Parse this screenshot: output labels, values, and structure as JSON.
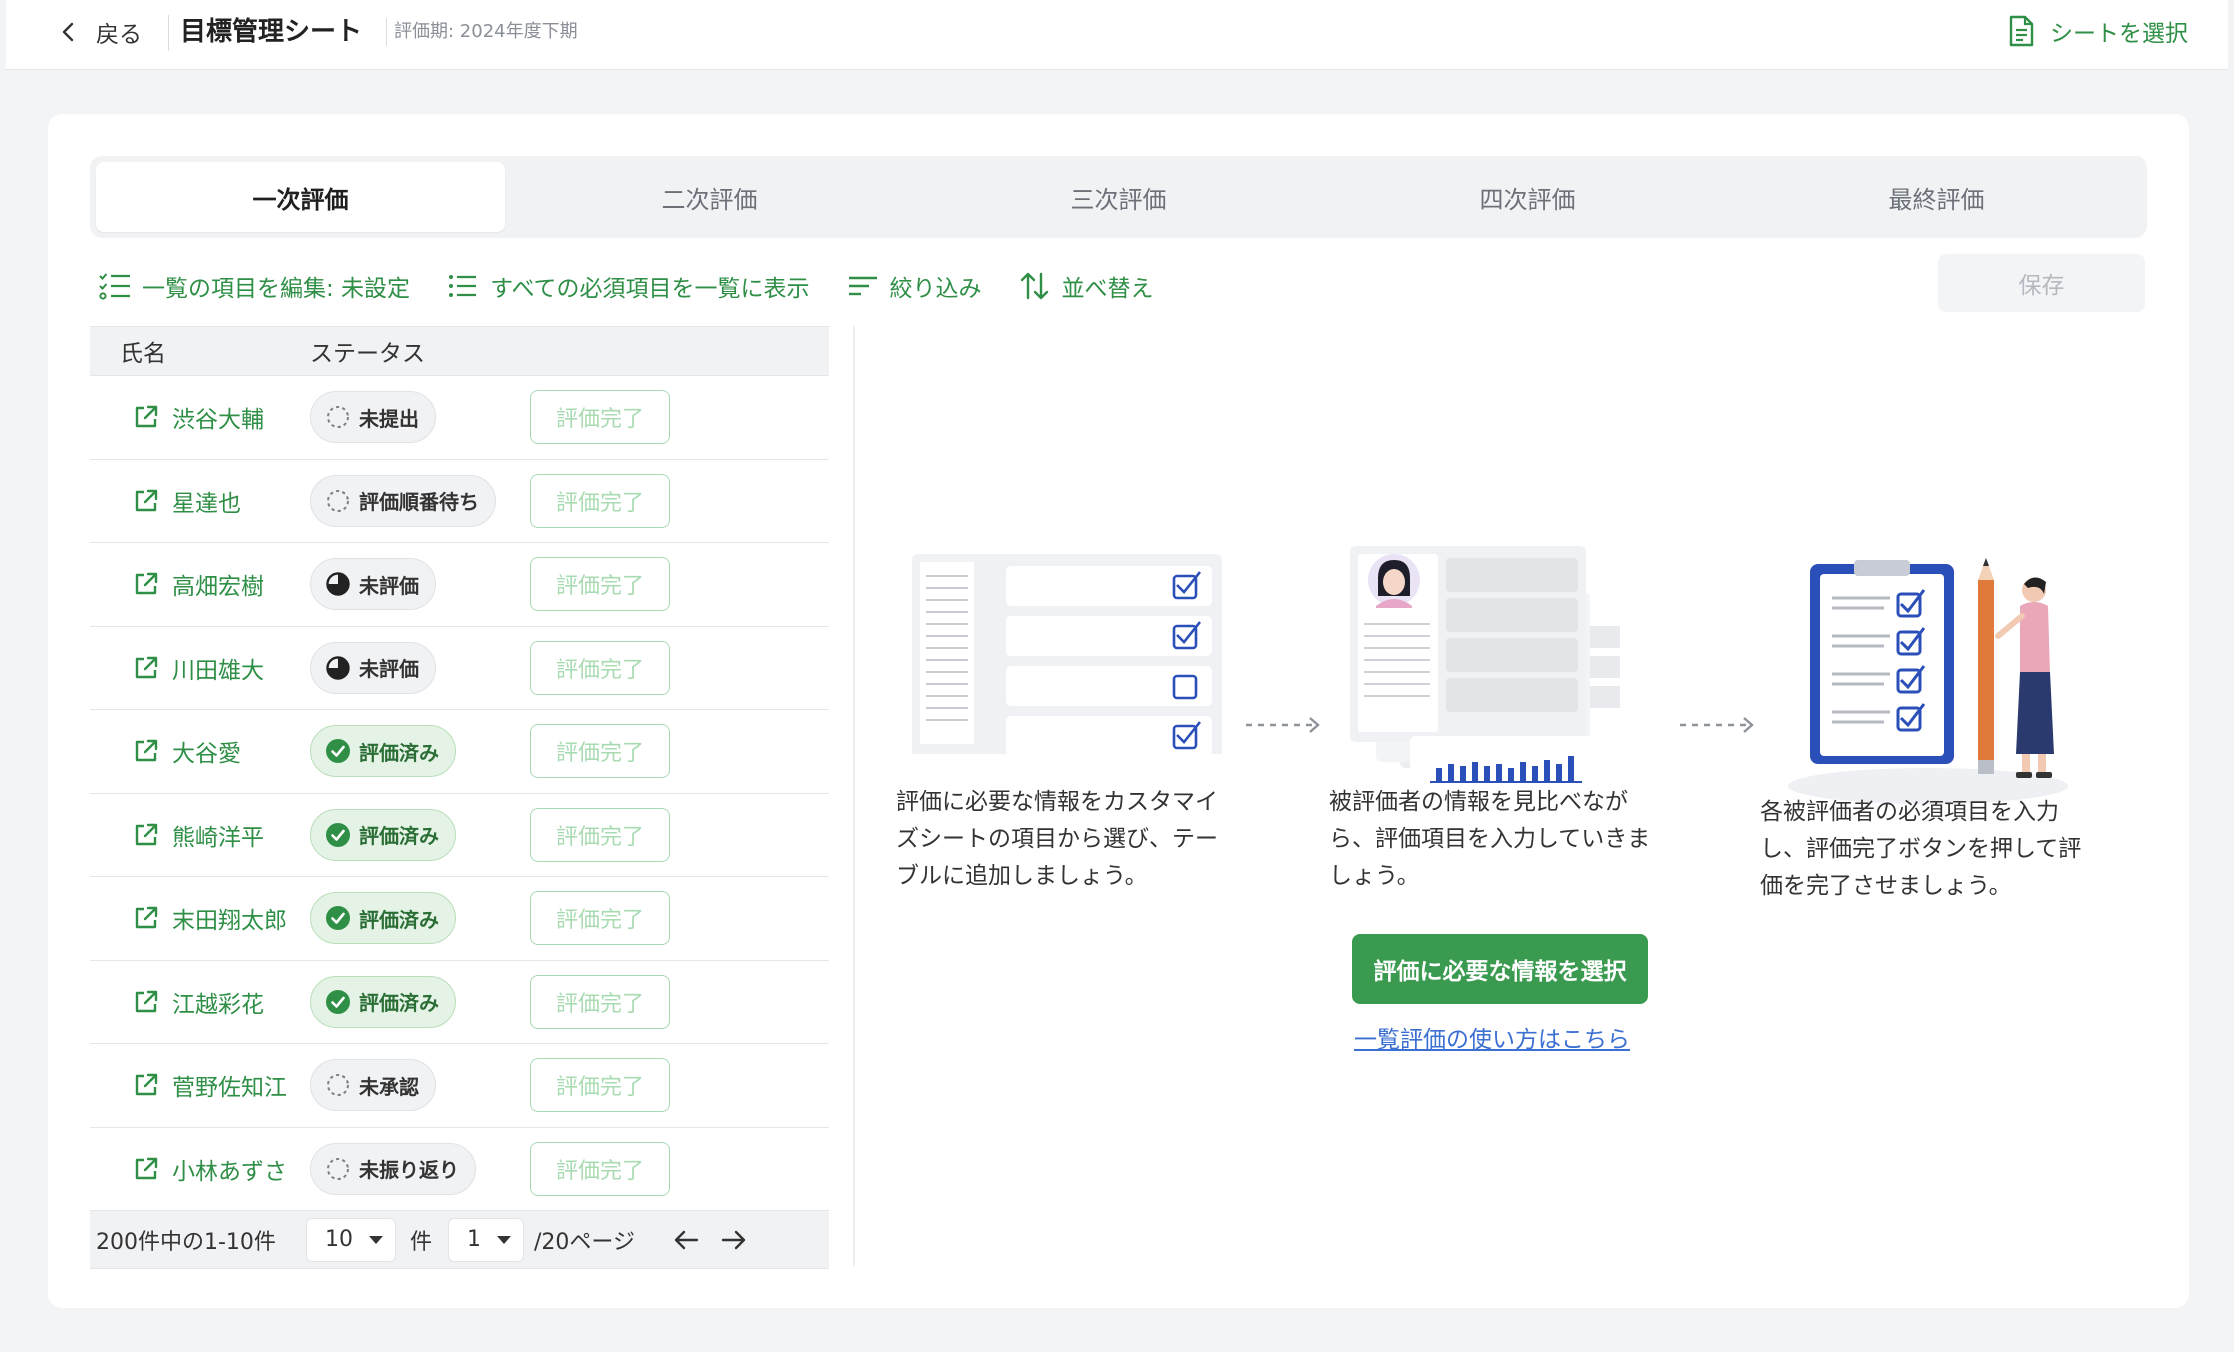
{
  "header": {
    "back_label": "戻る",
    "title": "目標管理シート",
    "period": "評価期: 2024年度下期",
    "select_sheet_label": "シートを選択"
  },
  "tabs": [
    "一次評価",
    "二次評価",
    "三次評価",
    "四次評価",
    "最終評価"
  ],
  "active_tab": "一次評価",
  "toolbar": {
    "edit_items": "一覧の項目を編集: 未設定",
    "show_required": "すべての必須項目を一覧に表示",
    "filter": "絞り込み",
    "sort": "並べ替え",
    "save": "保存"
  },
  "table": {
    "headers": {
      "name": "氏名",
      "status": "ステータス"
    },
    "complete_label": "評価完了",
    "rows": [
      {
        "name": "渋谷大輔",
        "status": "未提出",
        "status_type": "pending"
      },
      {
        "name": "星達也",
        "status": "評価順番待ち",
        "status_type": "pending"
      },
      {
        "name": "高畑宏樹",
        "status": "未評価",
        "status_type": "half"
      },
      {
        "name": "川田雄大",
        "status": "未評価",
        "status_type": "half"
      },
      {
        "name": "大谷愛",
        "status": "評価済み",
        "status_type": "done"
      },
      {
        "name": "熊崎洋平",
        "status": "評価済み",
        "status_type": "done"
      },
      {
        "name": "末田翔太郎",
        "status": "評価済み",
        "status_type": "done"
      },
      {
        "name": "江越彩花",
        "status": "評価済み",
        "status_type": "done"
      },
      {
        "name": "菅野佐知江",
        "status": "未承認",
        "status_type": "pending"
      },
      {
        "name": "小林あずさ",
        "status": "未振り返り",
        "status_type": "pending"
      }
    ]
  },
  "pagination": {
    "range": "200件中の1-10件",
    "per_page": "10",
    "unit": "件",
    "page": "1",
    "total_pages": "/20ページ"
  },
  "guide": {
    "step1_lines": [
      "評価に必要な情報をカスタマイ",
      "ズシートの項目から選び、テー",
      "ブルに追加しましょう。"
    ],
    "step2_lines": [
      "被評価者の情報を見比べなが",
      "ら、評価項目を入力していきま",
      "しょう。"
    ],
    "step3_lines": [
      "各被評価者の必須項目を入力",
      "し、評価完了ボタンを押して評",
      "価を完了させましょう。"
    ],
    "primary_button": "評価に必要な情報を選択",
    "help_link": "一覧評価の使い方はこちら"
  },
  "colors": {
    "accent_green": "#2f8f46",
    "button_green": "#3a9a4f",
    "done_badge_bg": "#e5f3e6",
    "link_blue": "#3b6fd2",
    "checkbox_blue": "#2b4fb8"
  },
  "icons": {
    "back": "chevron-left-icon",
    "select_sheet": "document-icon",
    "edit_items": "checklist-icon",
    "show_required": "list-icon",
    "filter": "filter-icon",
    "sort": "sort-arrows-icon",
    "row_link": "external-link-icon"
  }
}
